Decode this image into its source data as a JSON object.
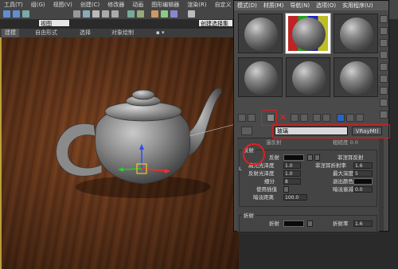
{
  "menu": [
    "工具(T)",
    "组(G)",
    "视图(V)",
    "创建(C)",
    "修改器",
    "动画",
    "图形编辑器",
    "渲染(R)",
    "自定义"
  ],
  "toolbar": {
    "view_select": "视图",
    "selection_set": "创建选择集"
  },
  "ribbon": {
    "tabs": [
      "建模",
      "自由形式",
      "选择",
      "对象绘制"
    ]
  },
  "material_editor": {
    "menu": [
      "模式(D)",
      "材质(M)",
      "导航(N)",
      "选项(O)",
      "实用程序(U)"
    ],
    "material_name": "玻璃",
    "material_type": "VRayMtl",
    "slots_count": 6,
    "active_slot_index": 1
  },
  "params": {
    "partial_top_left": "漫反射",
    "partial_top_right": "粗糙度 0.0",
    "section_title": "反射",
    "reflect": "反射",
    "hilight_gloss": "高光光泽度",
    "hilight_gloss_value": "1.0",
    "refl_gloss": "反射光泽度",
    "refl_gloss_value": "1.0",
    "subdivs": "细分",
    "subdivs_value": "8",
    "use_interp": "使用插值",
    "dim_distance": "暗淡距离",
    "dim_distance_value": "100.0",
    "fresnel": "菲涅耳反射",
    "fresnel_ior": "菲涅耳折射率",
    "fresnel_ior_value": "1.6",
    "max_depth": "最大深度",
    "max_depth_value": "5",
    "exit_color": "退出颜色",
    "dim_falloff": "暗淡衰减",
    "dim_falloff_value": "0.0",
    "L_label": "L",
    "refraction_section": "折射",
    "refract": "折射",
    "ior": "折射率",
    "ior_value": "1.6"
  },
  "colors": {
    "highlight_red": "#d42020",
    "viewport_wood": "#6e3b1c",
    "ui_dark": "#454545"
  }
}
